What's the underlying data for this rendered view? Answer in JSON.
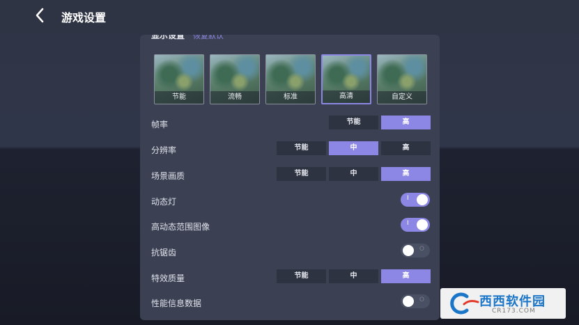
{
  "header": {
    "title": "游戏设置"
  },
  "display": {
    "title": "显示设置",
    "restore_link": "恢复默认"
  },
  "presets": [
    {
      "label": "节能",
      "selected": false
    },
    {
      "label": "流畅",
      "selected": false
    },
    {
      "label": "标准",
      "selected": false
    },
    {
      "label": "高清",
      "selected": true
    },
    {
      "label": "自定义",
      "selected": false
    }
  ],
  "settings": {
    "frame_rate": {
      "label": "帧率",
      "options": [
        "节能",
        "高"
      ],
      "selected": "高"
    },
    "resolution": {
      "label": "分辨率",
      "options": [
        "节能",
        "中",
        "高"
      ],
      "selected": "中"
    },
    "scene_quality": {
      "label": "场景画质",
      "options": [
        "节能",
        "中",
        "高"
      ],
      "selected": "高"
    },
    "dynamic_light": {
      "label": "动态灯",
      "value": true,
      "mark": "I"
    },
    "hdr": {
      "label": "高动态范围图像",
      "value": true,
      "mark": "I"
    },
    "anti_aliasing": {
      "label": "抗锯齿",
      "value": false,
      "mark": "O"
    },
    "effects_quality": {
      "label": "特效质量",
      "options": [
        "节能",
        "中",
        "高"
      ],
      "selected": "高"
    },
    "perf_info": {
      "label": "性能信息数据",
      "value": false,
      "mark": "O"
    }
  },
  "watermark": {
    "name": "西西软件园",
    "url": "CR173.COM"
  },
  "colors": {
    "accent": "#8c87e4",
    "panel": "#3b4153",
    "segment": "#2e3342"
  }
}
